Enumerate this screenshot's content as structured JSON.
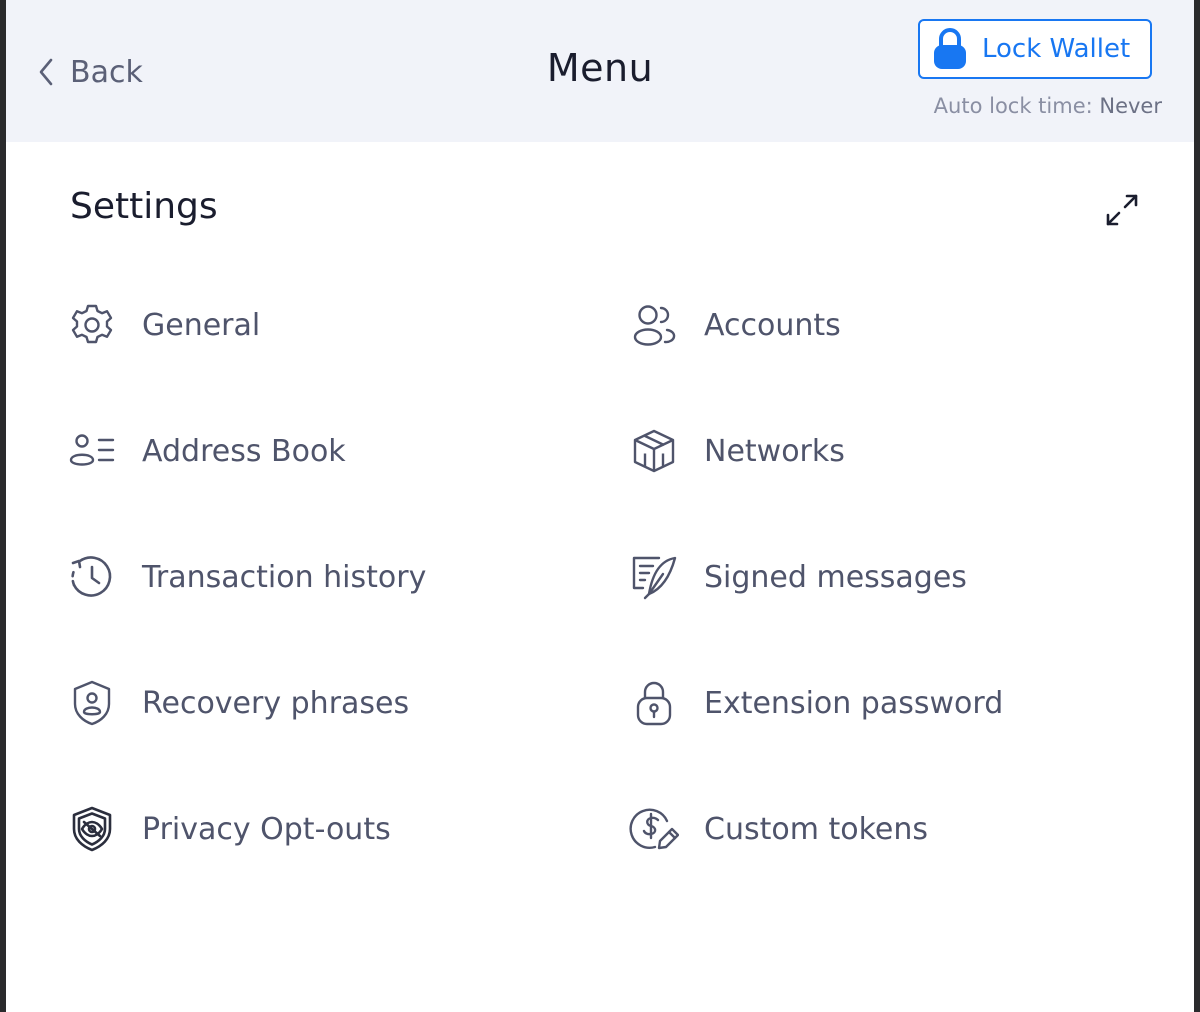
{
  "header": {
    "back_label": "Back",
    "title": "Menu",
    "lock_button_label": "Lock Wallet",
    "auto_lock_prefix": "Auto lock time: ",
    "auto_lock_value": "Never"
  },
  "settings": {
    "title": "Settings",
    "items": [
      {
        "label": "General",
        "icon": "gear-icon"
      },
      {
        "label": "Accounts",
        "icon": "accounts-icon"
      },
      {
        "label": "Address Book",
        "icon": "address-book-icon"
      },
      {
        "label": "Networks",
        "icon": "networks-icon"
      },
      {
        "label": "Transaction history",
        "icon": "history-icon"
      },
      {
        "label": "Signed messages",
        "icon": "signed-messages-icon"
      },
      {
        "label": "Recovery phrases",
        "icon": "shield-user-icon"
      },
      {
        "label": "Extension password",
        "icon": "padlock-icon"
      },
      {
        "label": "Privacy Opt-outs",
        "icon": "privacy-shield-icon"
      },
      {
        "label": "Custom tokens",
        "icon": "custom-token-icon"
      }
    ]
  },
  "colors": {
    "accent": "#1877f2",
    "header_bg": "#f1f3f9",
    "text_primary": "#1a1d2e",
    "text_secondary": "#4f546b",
    "icon_stroke": "#4f546b"
  }
}
